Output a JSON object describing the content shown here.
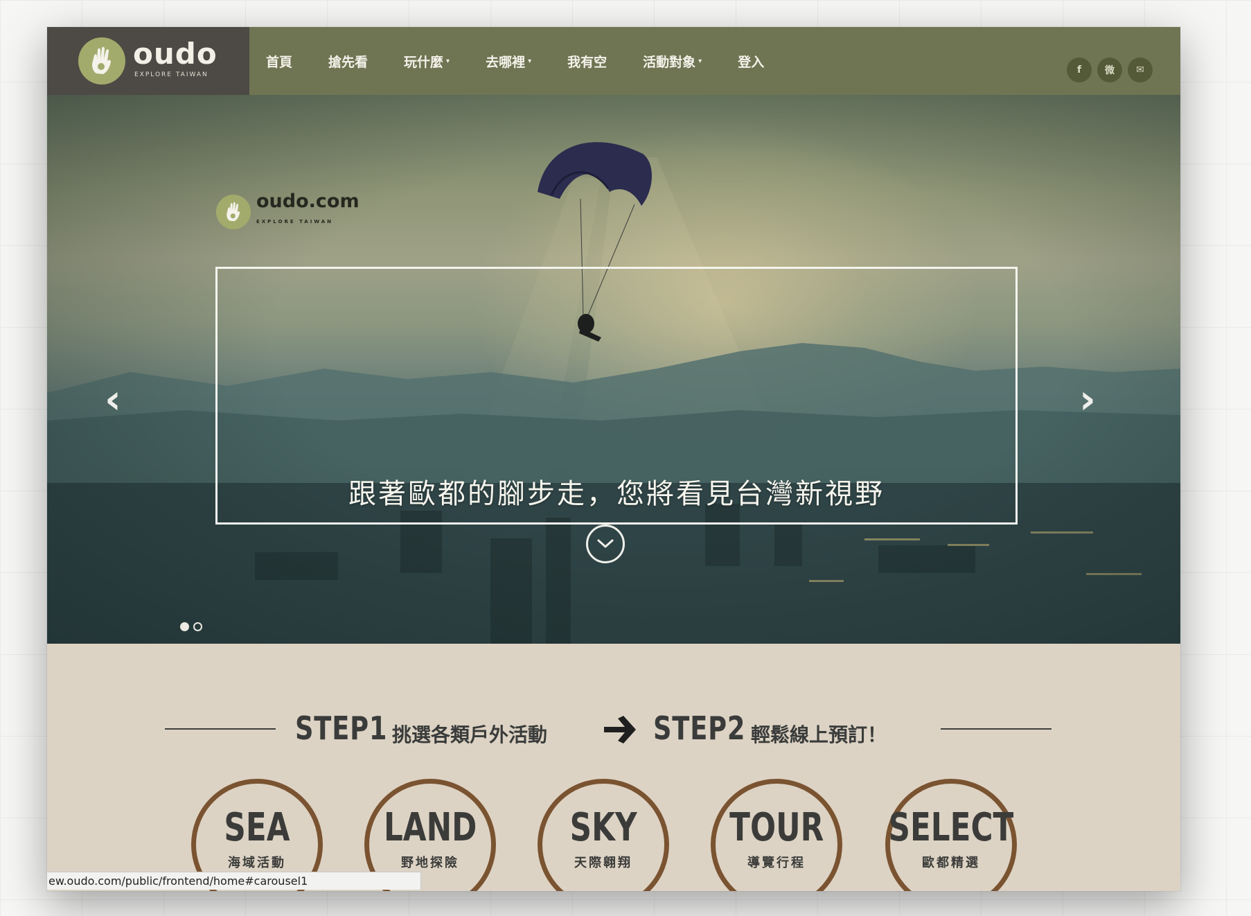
{
  "header": {
    "logo_text": "oudo",
    "logo_sub": "EXPLORE TAIWAN",
    "nav": [
      {
        "label": "首頁",
        "dropdown": false
      },
      {
        "label": "搶先看",
        "dropdown": false
      },
      {
        "label": "玩什麼",
        "dropdown": true
      },
      {
        "label": "去哪裡",
        "dropdown": true
      },
      {
        "label": "我有空",
        "dropdown": false
      },
      {
        "label": "活動對象",
        "dropdown": true
      },
      {
        "label": "登入",
        "dropdown": false
      }
    ],
    "social": [
      {
        "icon": "facebook-icon",
        "glyph": "f"
      },
      {
        "icon": "weibo-icon",
        "glyph": "微"
      },
      {
        "icon": "mail-icon",
        "glyph": "✉"
      }
    ]
  },
  "hero": {
    "logo_text": "oudo.com",
    "logo_sub": "EXPLORE TAIWAN",
    "caption": "跟著歐都的腳步走，您將看見台灣新視野",
    "prev_glyph": "‹",
    "next_glyph": "›",
    "slide_count": 2,
    "active_slide": 1
  },
  "steps": {
    "step1_label": "STEP1",
    "step1_desc": "挑選各類戶外活動",
    "step2_label": "STEP2",
    "step2_desc": "輕鬆線上預訂！",
    "categories": [
      {
        "title": "SEA",
        "sub": "海域活動"
      },
      {
        "title": "LAND",
        "sub": "野地探險"
      },
      {
        "title": "SKY",
        "sub": "天際翱翔"
      },
      {
        "title": "TOUR",
        "sub": "導覽行程"
      },
      {
        "title": "SELECT",
        "sub": "歐都精選"
      }
    ]
  },
  "status_url": "ew.oudo.com/public/frontend/home#carousel1",
  "colors": {
    "nav_bg": "#6f7453",
    "logo_bg": "#4d4a45",
    "logo_green": "#a2ab6c",
    "circle_border": "#7a5331",
    "paper_bg": "#ddd3c4"
  }
}
